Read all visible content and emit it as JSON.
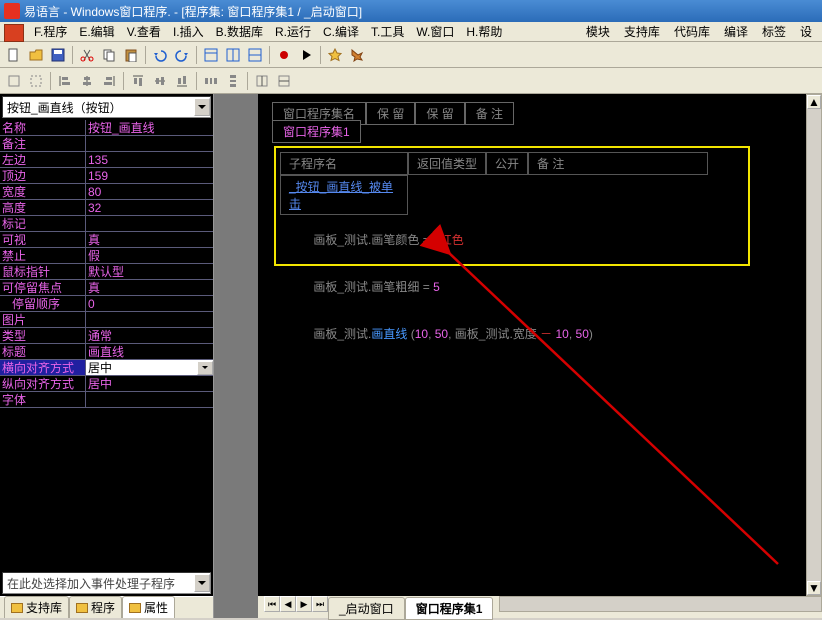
{
  "title": "易语言 - Windows窗口程序. - [程序集: 窗口程序集1 / _启动窗口]",
  "menus": {
    "file": "F.程序",
    "edit": "E.编辑",
    "view": "V.查看",
    "insert": "I.插入",
    "database": "B.数据库",
    "run": "R.运行",
    "compile": "C.编译",
    "tools": "T.工具",
    "window": "W.窗口",
    "help": "H.帮助"
  },
  "right_menus": {
    "module": "模块",
    "support": "支持库",
    "codelib": "代码库",
    "compile2": "编译",
    "tags": "标签",
    "settings": "设"
  },
  "combo": {
    "value": "按钮_画直线（按钮）"
  },
  "props": [
    {
      "name": "名称",
      "value": "按钮_画直线"
    },
    {
      "name": "备注",
      "value": ""
    },
    {
      "name": "左边",
      "value": "135"
    },
    {
      "name": "顶边",
      "value": "159"
    },
    {
      "name": "宽度",
      "value": "80"
    },
    {
      "name": "高度",
      "value": "32"
    },
    {
      "name": "标记",
      "value": ""
    },
    {
      "name": "可视",
      "value": "真"
    },
    {
      "name": "禁止",
      "value": "假"
    },
    {
      "name": "鼠标指针",
      "value": "默认型"
    },
    {
      "name": "可停留焦点",
      "value": "真"
    },
    {
      "name": "停留顺序",
      "value": "0",
      "indent": true
    },
    {
      "name": "图片",
      "value": ""
    },
    {
      "name": "类型",
      "value": "通常"
    },
    {
      "name": "标题",
      "value": "画直线"
    },
    {
      "name": "横向对齐方式",
      "value": "居中",
      "selected": true
    },
    {
      "name": "纵向对齐方式",
      "value": "居中"
    },
    {
      "name": "字体",
      "value": ""
    }
  ],
  "event_combo": "在此处选择加入事件处理子程序",
  "left_tabs": {
    "support": "支持库",
    "program": "程序",
    "property": "属性"
  },
  "code_tabs": {
    "row1": [
      "窗口程序集名",
      "保  留",
      "保  留",
      "备  注"
    ],
    "row2": "窗口程序集1"
  },
  "sub_header": [
    "子程序名",
    "返回值类型",
    "公开",
    "备  注"
  ],
  "sub_name": "_按钮_画直线_被单击",
  "code": {
    "l1_a": "画板_测试.",
    "l1_b": "画笔颜色",
    "l1_eq": " = ",
    "l1_v": "#红色",
    "l2_a": "画板_测试.",
    "l2_b": "画笔粗细",
    "l2_eq": " = ",
    "l2_v": "5",
    "l3_a": "画板_测试.",
    "l3_b": "画直线",
    "l3_p1": " (",
    "l3_n1": "10",
    "l3_c1": ", ",
    "l3_n2": "50",
    "l3_c2": ", ",
    "l3_mid": "画板_测试.",
    "l3_attr": "宽度",
    "l3_minus": " － ",
    "l3_n3": "10",
    "l3_c3": ", ",
    "l3_n4": "50",
    "l3_p2": ")"
  },
  "editor_tabs": {
    "t1": "_启动窗口",
    "t2": "窗口程序集1"
  }
}
